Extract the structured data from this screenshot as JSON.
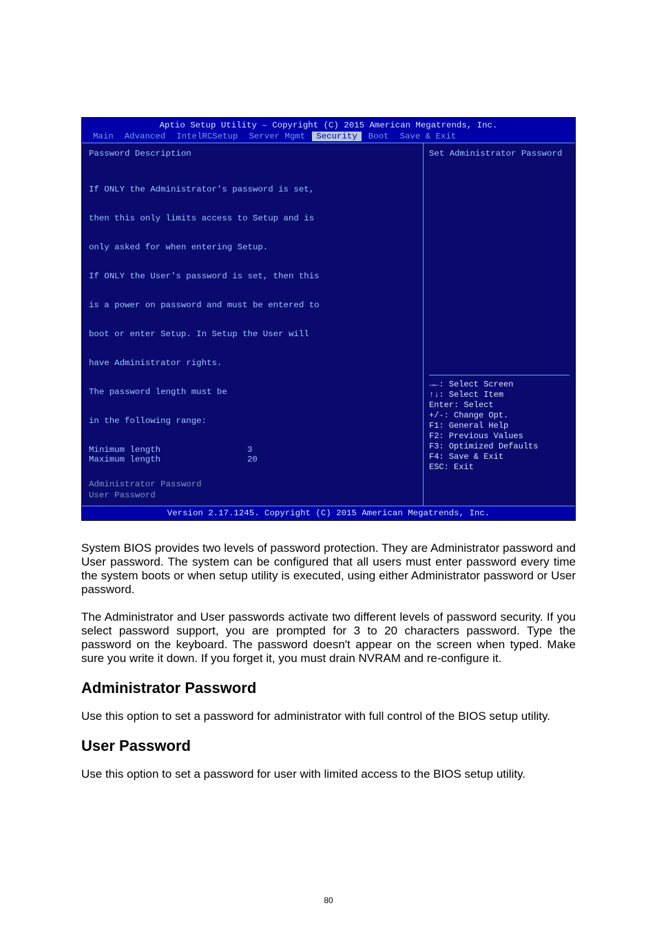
{
  "bios": {
    "header_title": "Aptio Setup Utility – Copyright (C) 2015 American Megatrends, Inc.",
    "tabs": [
      "Main",
      "Advanced",
      "IntelRCSetup",
      "Server Mgmt",
      "Security",
      "Boot",
      "Save & Exit"
    ],
    "selected_tab_index": 4,
    "left": {
      "title": "Password Description",
      "desc_lines": [
        "If ONLY the Administrator's password is set,",
        "then this only limits access to Setup and is",
        "only asked for when entering Setup.",
        "If ONLY the User's password is set, then this",
        "is a power on password and must be entered to",
        "boot or enter Setup. In Setup the User will",
        "have Administrator rights.",
        "The password length must be",
        "in the following range:"
      ],
      "min_label": "Minimum length",
      "min_value": "3",
      "max_label": "Maximum length",
      "max_value": "20",
      "opt_admin": "Administrator Password",
      "opt_user": "User Password"
    },
    "right": {
      "tip": "Set Administrator Password",
      "help": [
        "→←: Select Screen",
        "↑↓: Select Item",
        "Enter: Select",
        "+/-: Change Opt.",
        "F1: General Help",
        "F2: Previous Values",
        "F3: Optimized Defaults",
        "F4: Save & Exit",
        "ESC: Exit"
      ]
    },
    "footer": "Version 2.17.1245. Copyright (C) 2015 American Megatrends, Inc."
  },
  "doc": {
    "p1": "System BIOS provides two levels of password protection. They are Administrator password and User password. The system can be configured that all users must enter password every time the system boots or when setup utility is executed, using either Administrator password or User password.",
    "p2": "The Administrator and User passwords activate two different levels of password security. If you select password support, you are prompted for 3 to 20 characters password. Type the password on the keyboard. The password doesn't appear on the screen when typed. Make sure you write it down. If you forget it, you must drain NVRAM and re-configure it.",
    "h1": "Administrator Password",
    "p3": "Use this option to set a password for administrator with full control of the BIOS setup utility.",
    "h2": "User Password",
    "p4": "Use this option to set a password for user with limited access to the BIOS setup utility."
  },
  "page_number": "80"
}
